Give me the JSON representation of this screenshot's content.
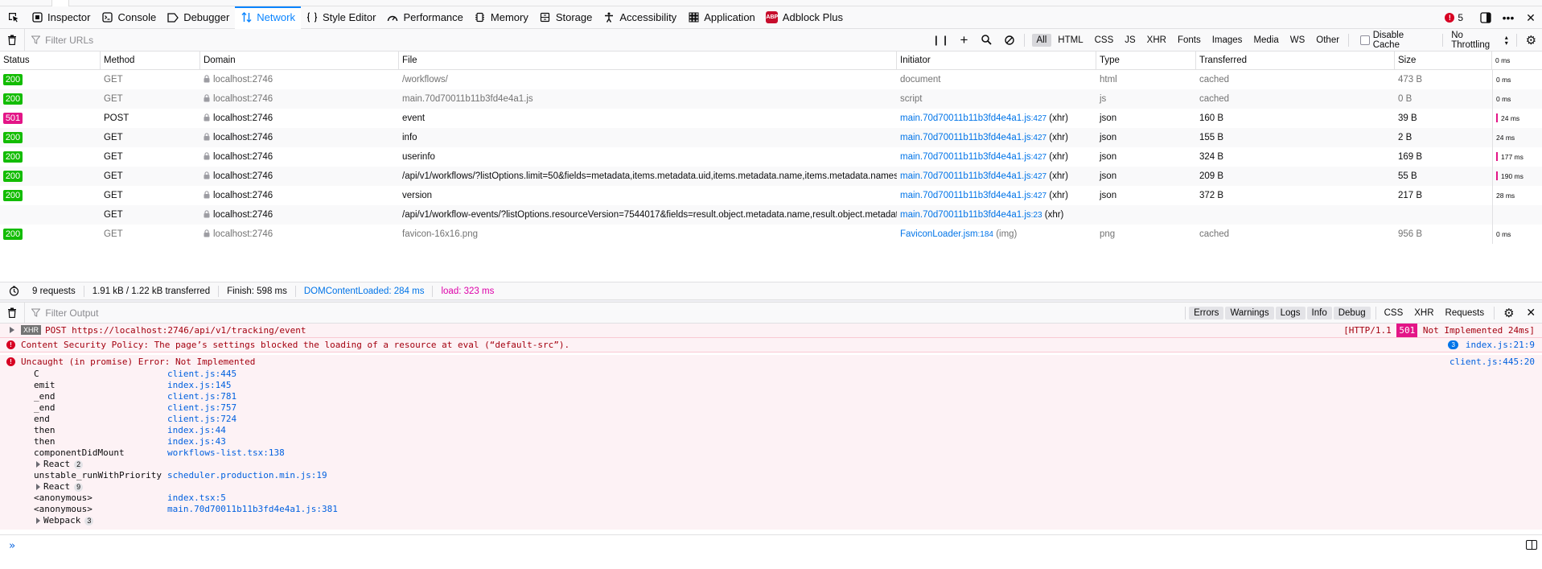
{
  "toolbox": {
    "tabs": [
      {
        "label": "Inspector",
        "icon": "inspector-icon"
      },
      {
        "label": "Console",
        "icon": "console-icon"
      },
      {
        "label": "Debugger",
        "icon": "debugger-icon"
      },
      {
        "label": "Network",
        "icon": "network-icon",
        "active": true
      },
      {
        "label": "Style Editor",
        "icon": "style-editor-icon"
      },
      {
        "label": "Performance",
        "icon": "performance-icon"
      },
      {
        "label": "Memory",
        "icon": "memory-icon"
      },
      {
        "label": "Storage",
        "icon": "storage-icon"
      },
      {
        "label": "Accessibility",
        "icon": "accessibility-icon"
      },
      {
        "label": "Application",
        "icon": "application-icon"
      },
      {
        "label": "Adblock Plus",
        "icon": "adblock-plus-icon",
        "abp_text": "ABP"
      }
    ],
    "error_count": "5",
    "accent": "#0a84ff"
  },
  "network_toolbar": {
    "filter_placeholder": "Filter URLs",
    "type_filters": [
      "All",
      "HTML",
      "CSS",
      "JS",
      "XHR",
      "Fonts",
      "Images",
      "Media",
      "WS",
      "Other"
    ],
    "active_filter": "All",
    "disable_cache_label": "Disable Cache",
    "throttling_label": "No Throttling"
  },
  "table": {
    "headers": {
      "status": "Status",
      "method": "Method",
      "domain": "Domain",
      "file": "File",
      "initiator": "Initiator",
      "type": "Type",
      "transferred": "Transferred",
      "size": "Size",
      "waterfall": "0 ms"
    },
    "rows": [
      {
        "status": "200",
        "kind": "ok",
        "method": "GET",
        "domain": "localhost:2746",
        "file": "/workflows/",
        "init_text": "document",
        "init_line": "",
        "init_suffix": "",
        "type": "html",
        "transferred": "cached",
        "size": "473 B",
        "wf": "0 ms",
        "bar": false,
        "muted": true
      },
      {
        "status": "200",
        "kind": "ok",
        "method": "GET",
        "domain": "localhost:2746",
        "file": "main.70d70011b11b3fd4e4a1.js",
        "init_text": "script",
        "init_line": "",
        "init_suffix": "",
        "type": "js",
        "transferred": "cached",
        "size": "0 B",
        "wf": "0 ms",
        "bar": false,
        "muted": true
      },
      {
        "status": "501",
        "kind": "bad",
        "method": "POST",
        "domain": "localhost:2746",
        "file": "event",
        "init_text": "main.70d70011b11b3fd4e4a1.js",
        "init_line": ":427",
        "init_suffix": " (xhr)",
        "type": "json",
        "transferred": "160 B",
        "size": "39 B",
        "wf": "24 ms",
        "bar": true,
        "muted": false
      },
      {
        "status": "200",
        "kind": "ok",
        "method": "GET",
        "domain": "localhost:2746",
        "file": "info",
        "init_text": "main.70d70011b11b3fd4e4a1.js",
        "init_line": ":427",
        "init_suffix": " (xhr)",
        "type": "json",
        "transferred": "155 B",
        "size": "2 B",
        "wf": "24 ms",
        "bar": false,
        "muted": false
      },
      {
        "status": "200",
        "kind": "ok",
        "method": "GET",
        "domain": "localhost:2746",
        "file": "userinfo",
        "init_text": "main.70d70011b11b3fd4e4a1.js",
        "init_line": ":427",
        "init_suffix": " (xhr)",
        "type": "json",
        "transferred": "324 B",
        "size": "169 B",
        "wf": "177 ms",
        "bar": true,
        "muted": false
      },
      {
        "status": "200",
        "kind": "ok",
        "method": "GET",
        "domain": "localhost:2746",
        "file": "/api/v1/workflows/?listOptions.limit=50&fields=metadata,items.metadata.uid,items.metadata.name,items.metadata.names",
        "init_text": "main.70d70011b11b3fd4e4a1.js",
        "init_line": ":427",
        "init_suffix": " (xhr)",
        "type": "json",
        "transferred": "209 B",
        "size": "55 B",
        "wf": "190 ms",
        "bar": true,
        "muted": false
      },
      {
        "status": "200",
        "kind": "ok",
        "method": "GET",
        "domain": "localhost:2746",
        "file": "version",
        "init_text": "main.70d70011b11b3fd4e4a1.js",
        "init_line": ":427",
        "init_suffix": " (xhr)",
        "type": "json",
        "transferred": "372 B",
        "size": "217 B",
        "wf": "28 ms",
        "bar": false,
        "muted": false
      },
      {
        "status": "",
        "kind": "none",
        "method": "GET",
        "domain": "localhost:2746",
        "file": "/api/v1/workflow-events/?listOptions.resourceVersion=7544017&fields=result.object.metadata.name,result.object.metadata",
        "init_text": "main.70d70011b11b3fd4e4a1.js",
        "init_line": ":23",
        "init_suffix": " (xhr)",
        "type": "",
        "transferred": "",
        "size": "",
        "wf": "",
        "bar": false,
        "muted": false
      },
      {
        "status": "200",
        "kind": "ok",
        "method": "GET",
        "domain": "localhost:2746",
        "file": "favicon-16x16.png",
        "init_text": "FaviconLoader.jsm",
        "init_line": ":184",
        "init_suffix": " (img)",
        "type": "png",
        "transferred": "cached",
        "size": "956 B",
        "wf": "0 ms",
        "bar": false,
        "muted": true
      }
    ]
  },
  "net_status": {
    "requests": "9 requests",
    "transferred": "1.91 kB / 1.22 kB transferred",
    "finish": "Finish: 598 ms",
    "dcl": "DOMContentLoaded: 284 ms",
    "load": "load: 323 ms"
  },
  "console_toolbar": {
    "filter_placeholder": "Filter Output",
    "levels": [
      "Errors",
      "Warnings",
      "Logs",
      "Info",
      "Debug"
    ],
    "extras": [
      "CSS",
      "XHR",
      "Requests"
    ]
  },
  "console": {
    "xhr": {
      "badge": "XHR",
      "text": "POST https://localhost:2746/api/v1/tracking/event",
      "http_pre": "[HTTP/1.1 ",
      "http_code": "501",
      "http_post": " Not Implemented 24ms]"
    },
    "csp": {
      "text": "Content Security Policy: The page’s settings blocked the loading of a resource at eval (“default-src”).",
      "repeat": "3",
      "location": "index.js:21:9"
    },
    "error": {
      "text": "Uncaught (in promise) Error: Not Implemented",
      "location": "client.js:445:20",
      "stack": [
        {
          "kind": "frame",
          "fn": "C",
          "loc": "client.js:445"
        },
        {
          "kind": "frame",
          "fn": "emit",
          "loc": "index.js:145"
        },
        {
          "kind": "frame",
          "fn": "_end",
          "loc": "client.js:781"
        },
        {
          "kind": "frame",
          "fn": "_end",
          "loc": "client.js:757"
        },
        {
          "kind": "frame",
          "fn": "end",
          "loc": "client.js:724"
        },
        {
          "kind": "frame",
          "fn": "then",
          "loc": "index.js:44"
        },
        {
          "kind": "frame",
          "fn": "then",
          "loc": "index.js:43"
        },
        {
          "kind": "frame",
          "fn": "componentDidMount",
          "loc": "workflows-list.tsx:138"
        },
        {
          "kind": "group",
          "fn": "React",
          "count": "2"
        },
        {
          "kind": "frame",
          "fn": "unstable_runWithPriority",
          "loc": "scheduler.production.min.js:19"
        },
        {
          "kind": "group",
          "fn": "React",
          "count": "9"
        },
        {
          "kind": "frame",
          "fn": "<anonymous>",
          "loc": "index.tsx:5"
        },
        {
          "kind": "frame",
          "fn": "<anonymous>",
          "loc": "main.70d70011b11b3fd4e4a1.js:381"
        },
        {
          "kind": "group",
          "fn": "Webpack",
          "count": "3"
        }
      ]
    },
    "prompt": "»"
  }
}
